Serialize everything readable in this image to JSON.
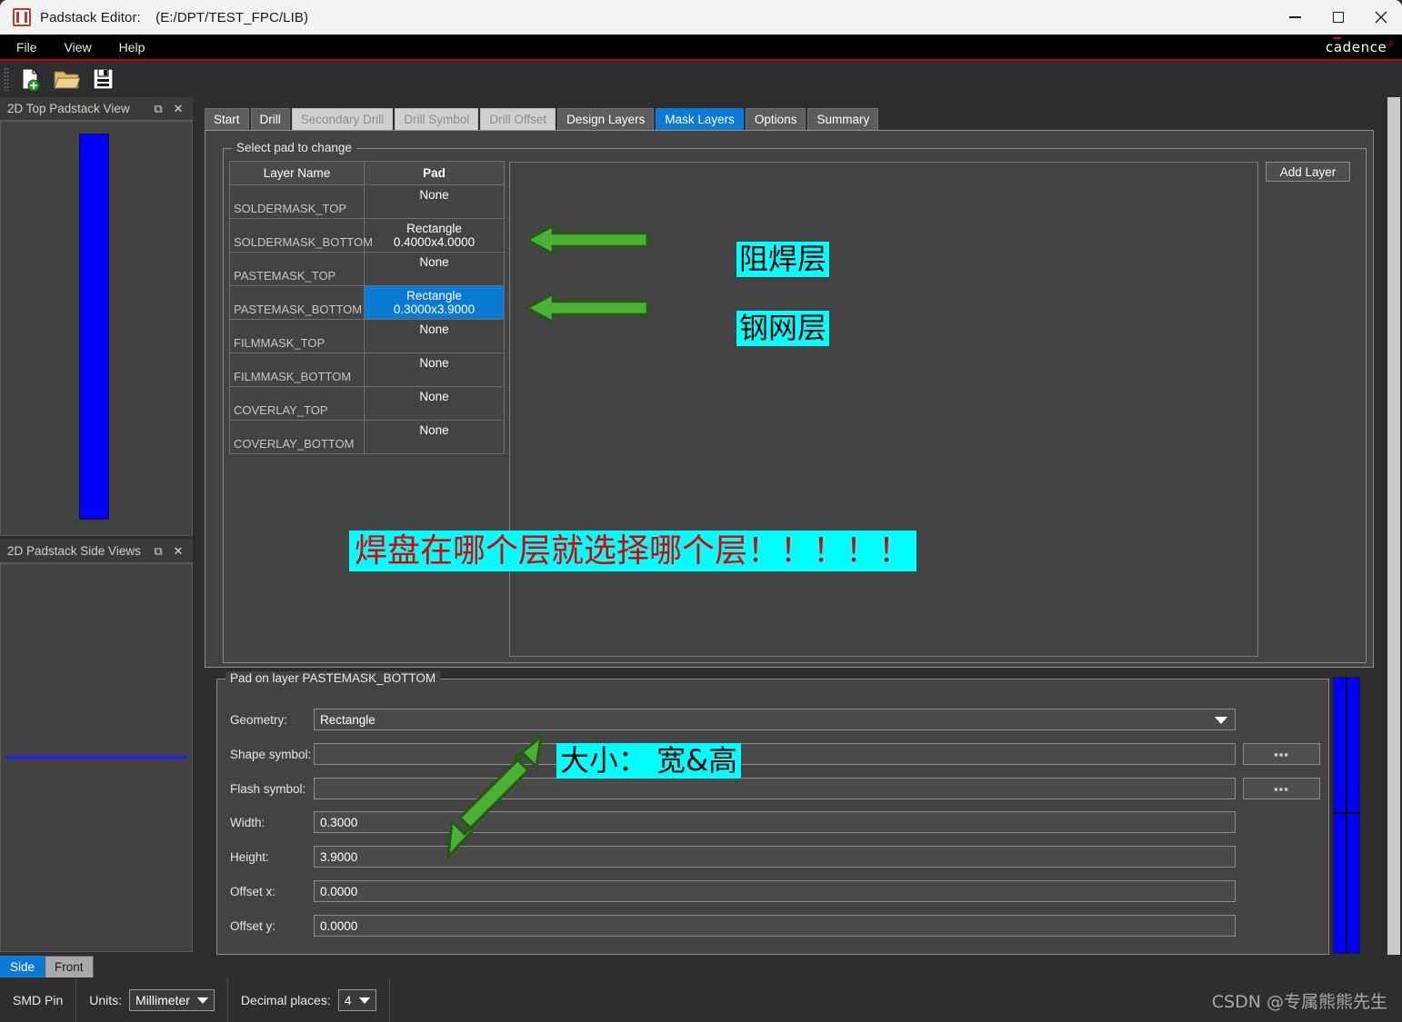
{
  "window": {
    "title": "Padstack Editor:",
    "path": "(E:/DPT/TEST_FPC/LIB)",
    "app_icon": "padstack-editor-icon",
    "minimize": "—",
    "maximize": "□",
    "close": "✕"
  },
  "menu": {
    "items": [
      {
        "label": "File"
      },
      {
        "label": "View"
      },
      {
        "label": "Help"
      }
    ],
    "brand": "cadence",
    "brand_reg": "®"
  },
  "toolbar": {
    "buttons": [
      {
        "icon": "new-file-icon",
        "label": "New"
      },
      {
        "icon": "open-folder-icon",
        "label": "Open"
      },
      {
        "icon": "save-disk-icon",
        "label": "Save"
      }
    ]
  },
  "left_panels": [
    {
      "title": "2D Top Padstack View",
      "float_icon": "⧉",
      "close_icon": "✕",
      "pad_color": "#0000ff"
    },
    {
      "title": "2D Padstack Side Views",
      "float_icon": "⧉",
      "close_icon": "✕",
      "pad_color": "#2222e0"
    }
  ],
  "side_view_tabs": [
    {
      "label": "Side",
      "state": "active"
    },
    {
      "label": "Front",
      "state": "inactive"
    }
  ],
  "tabs": [
    {
      "label": "Start",
      "state": "normal"
    },
    {
      "label": "Drill",
      "state": "normal"
    },
    {
      "label": "Secondary Drill",
      "state": "disabled"
    },
    {
      "label": "Drill Symbol",
      "state": "disabled"
    },
    {
      "label": "Drill Offset",
      "state": "disabled"
    },
    {
      "label": "Design Layers",
      "state": "normal"
    },
    {
      "label": "Mask Layers",
      "state": "active"
    },
    {
      "label": "Options",
      "state": "normal"
    },
    {
      "label": "Summary",
      "state": "normal"
    }
  ],
  "select_pad": {
    "group_title": "Select pad to change",
    "add_layer_label": "Add Layer",
    "columns": [
      "Layer Name",
      "Pad"
    ],
    "rows": [
      {
        "layer": "SOLDERMASK_TOP",
        "pad": "None",
        "selected": false
      },
      {
        "layer": "SOLDERMASK_BOTTOM",
        "pad": "Rectangle 0.4000x4.0000",
        "selected": false
      },
      {
        "layer": "PASTEMASK_TOP",
        "pad": "None",
        "selected": false
      },
      {
        "layer": "PASTEMASK_BOTTOM",
        "pad": "Rectangle 0.3000x3.9000",
        "selected": true
      },
      {
        "layer": "FILMMASK_TOP",
        "pad": "None",
        "selected": false
      },
      {
        "layer": "FILMMASK_BOTTOM",
        "pad": "None",
        "selected": false
      },
      {
        "layer": "COVERLAY_TOP",
        "pad": "None",
        "selected": false
      },
      {
        "layer": "COVERLAY_BOTTOM",
        "pad": "None",
        "selected": false
      }
    ]
  },
  "pad_form": {
    "group_title": "Pad on layer PASTEMASK_BOTTOM",
    "fields": {
      "geometry_label": "Geometry:",
      "geometry_value": "Rectangle",
      "shape_symbol_label": "Shape symbol:",
      "shape_symbol_value": "",
      "flash_symbol_label": "Flash symbol:",
      "flash_symbol_value": "",
      "width_label": "Width:",
      "width_value": "0.3000",
      "height_label": "Height:",
      "height_value": "3.9000",
      "offset_x_label": "Offset x:",
      "offset_x_value": "0.0000",
      "offset_y_label": "Offset y:",
      "offset_y_value": "0.0000"
    },
    "browse_label": "▪▪▪"
  },
  "statusbar": {
    "pin_type": "SMD Pin",
    "units_label": "Units:",
    "units_value": "Millimeter",
    "decimal_label": "Decimal places:",
    "decimal_value": "4",
    "watermark": "CSDN @专属熊熊先生"
  },
  "annotations": {
    "soldermask_label": "阻焊层",
    "pastemask_label": "钢网层",
    "banner": "焊盘在哪个层就选择哪个层！！！！！",
    "size_hint": "大小： 宽&高",
    "arrow_color": "#4caf36",
    "arrow_edge_color": "#1f5c10",
    "highlight_color": "#00ffff",
    "banner_text_color": "#e00000"
  }
}
